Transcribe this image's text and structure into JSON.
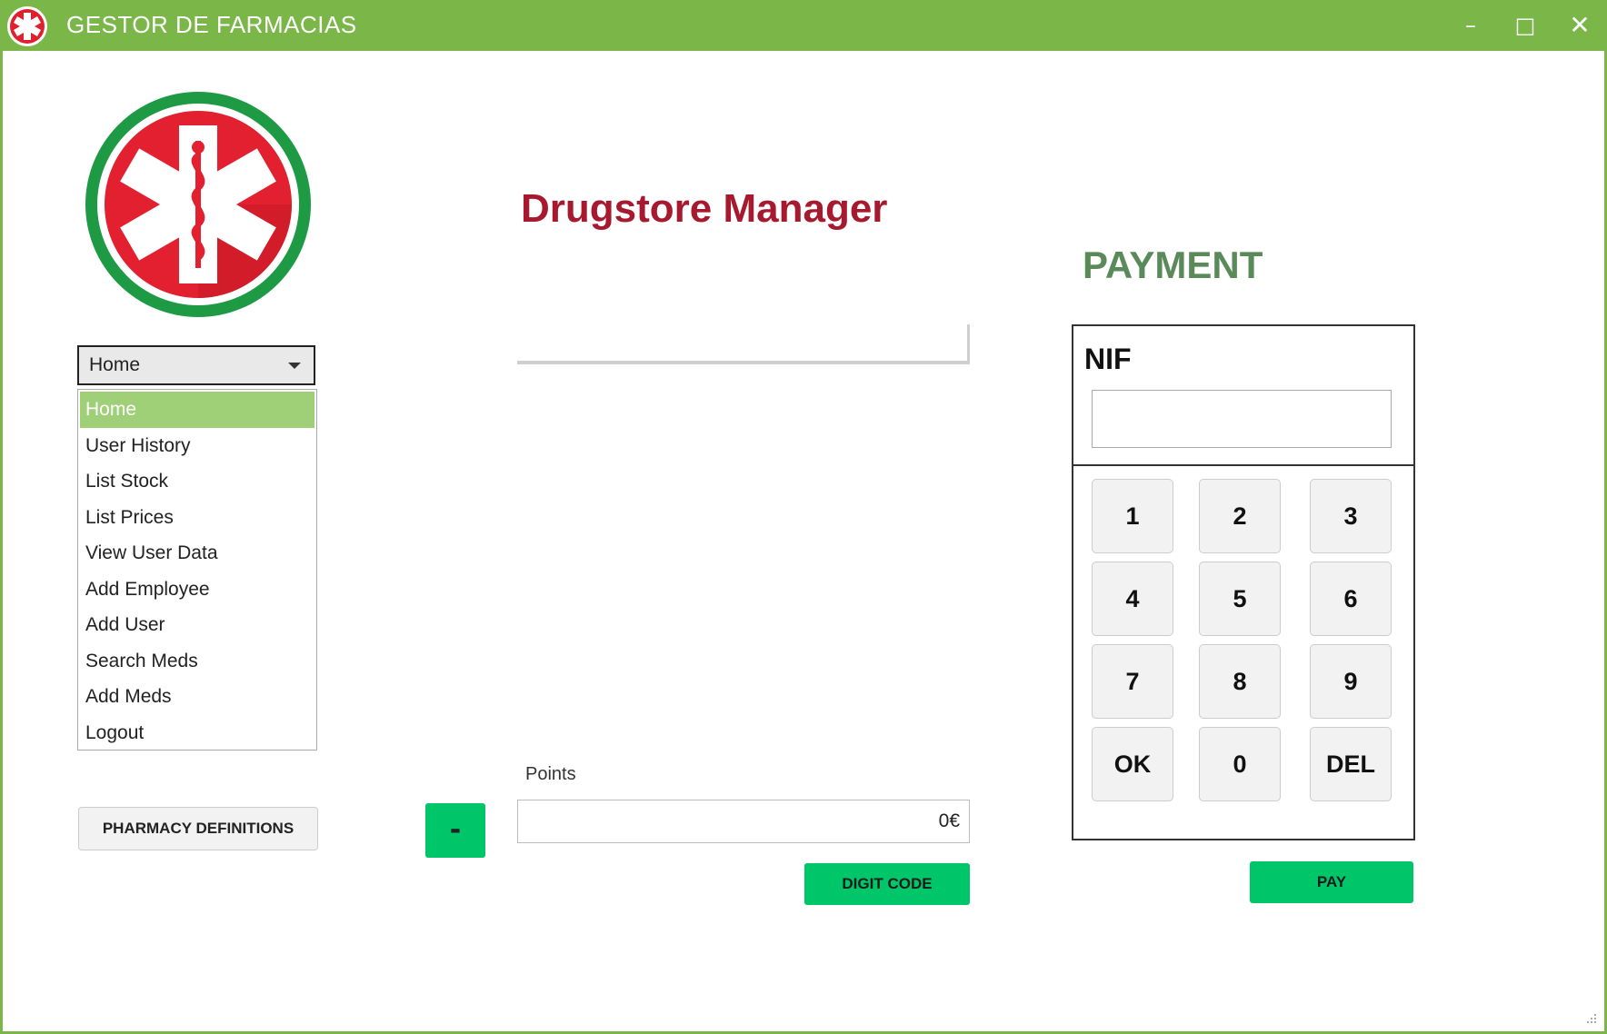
{
  "window": {
    "title": "GESTOR DE FARMACIAS"
  },
  "heading": "Drugstore Manager",
  "payment_title": "PAYMENT",
  "menu": {
    "selected": "Home",
    "items": [
      {
        "label": "Home"
      },
      {
        "label": "User History"
      },
      {
        "label": "List Stock"
      },
      {
        "label": "List Prices"
      },
      {
        "label": "View User Data"
      },
      {
        "label": "Add Employee"
      },
      {
        "label": "Add User"
      },
      {
        "label": "Search Meds"
      },
      {
        "label": "Add Meds"
      },
      {
        "label": "Logout"
      }
    ]
  },
  "buttons": {
    "pharmacy_definitions": "PHARMACY DEFINITIONS",
    "minus": "-",
    "digit_code": "DIGIT CODE",
    "pay": "PAY"
  },
  "points": {
    "label": "Points",
    "value": "0€"
  },
  "nif": {
    "label": "NIF",
    "value": ""
  },
  "keypad": [
    "1",
    "2",
    "3",
    "4",
    "5",
    "6",
    "7",
    "8",
    "9",
    "OK",
    "0",
    "DEL"
  ],
  "colors": {
    "title_bar": "#7ab648",
    "accent_green": "#00c66a",
    "heading": "#a6192e",
    "payment": "#5a8a5a"
  }
}
